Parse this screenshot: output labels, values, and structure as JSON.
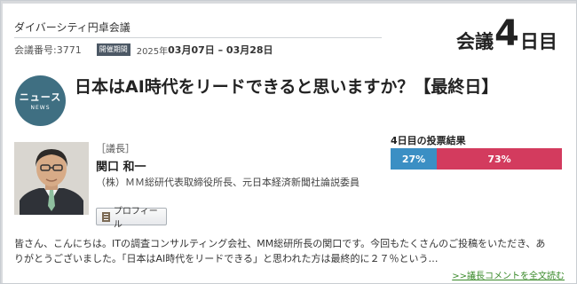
{
  "header": {
    "series_title": "ダイバーシティ円卓会議",
    "meeting_id": "会議番号:3771",
    "period_badge": "開催期間",
    "period_year": "2025年",
    "period_range": "03月07日 – 03月28日"
  },
  "day_indicator": {
    "prefix": "会議",
    "number": "4",
    "suffix": "日目"
  },
  "news_icon": {
    "main_text": "ニュース",
    "sub_text": "NEWS"
  },
  "headline": "日本はAI時代をリードできると思いますか？【最終日】",
  "chair": {
    "role": "［議長］",
    "name": "関口 和一",
    "affiliation": "（株）ＭＭ総研代表取締役所長、元日本経済新聞社論説委員",
    "profile_button": "プロフィール"
  },
  "vote": {
    "title": "4日目の投票結果",
    "yes_percent": 27,
    "no_percent": 73,
    "yes_label": "27%",
    "no_label": "73%",
    "yes_color": "#3b8fc4",
    "no_color": "#d33b5e"
  },
  "body_text": "皆さん、こんにちは。ITの調査コンサルティング会社、MM総研所長の関口です。今回もたくさんのご投稿をいただき、ありがとうございました。「日本はAI時代をリードできる」と思われた方は最終的に２７％という…",
  "more_link": ">>議長コメントを全文読む"
}
